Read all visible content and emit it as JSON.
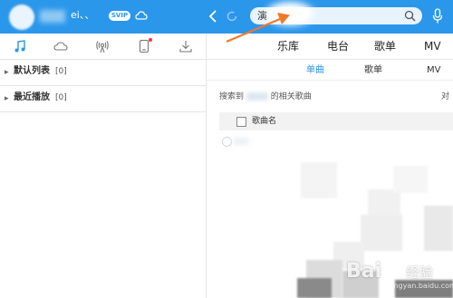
{
  "topbar": {
    "username": "ei、、",
    "vip_badge": "SVIP",
    "search_value": "演"
  },
  "sidebar": {
    "items": [
      {
        "label": "默认列表",
        "count": "[0]"
      },
      {
        "label": "最近播放",
        "count": "[0]"
      }
    ]
  },
  "main": {
    "tabs": [
      "乐库",
      "电台",
      "歌单",
      "MV"
    ],
    "subtabs": [
      "单曲",
      "歌单",
      "MV"
    ],
    "result_prefix": "搜索到",
    "result_suffix": "的相关歌曲",
    "result_right": "对",
    "column_song": "歌曲名"
  },
  "watermark": {
    "logo_text": "Bai",
    "suffix_text": "经验",
    "url_text": "jingyan.baidu.com"
  },
  "colors": {
    "accent": "#2b97eb",
    "annotation_arrow": "#f07a2a"
  }
}
